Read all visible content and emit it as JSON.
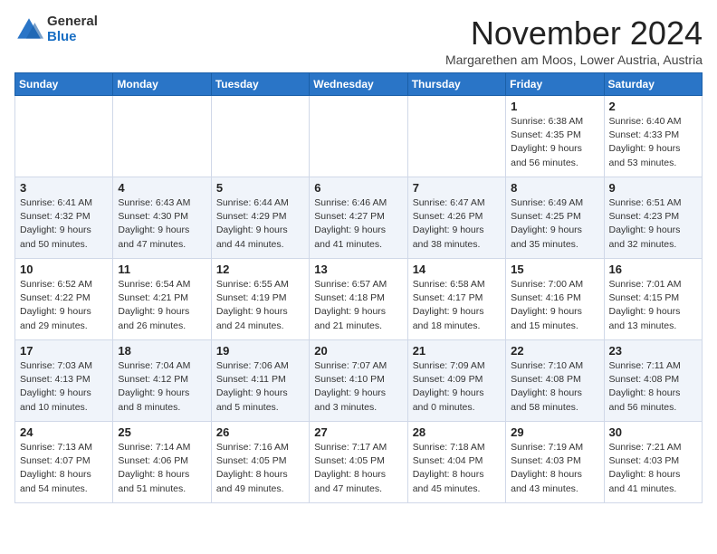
{
  "logo": {
    "general": "General",
    "blue": "Blue"
  },
  "title": "November 2024",
  "location": "Margarethen am Moos, Lower Austria, Austria",
  "weekdays": [
    "Sunday",
    "Monday",
    "Tuesday",
    "Wednesday",
    "Thursday",
    "Friday",
    "Saturday"
  ],
  "weeks": [
    [
      {
        "day": "",
        "info": ""
      },
      {
        "day": "",
        "info": ""
      },
      {
        "day": "",
        "info": ""
      },
      {
        "day": "",
        "info": ""
      },
      {
        "day": "",
        "info": ""
      },
      {
        "day": "1",
        "info": "Sunrise: 6:38 AM\nSunset: 4:35 PM\nDaylight: 9 hours\nand 56 minutes."
      },
      {
        "day": "2",
        "info": "Sunrise: 6:40 AM\nSunset: 4:33 PM\nDaylight: 9 hours\nand 53 minutes."
      }
    ],
    [
      {
        "day": "3",
        "info": "Sunrise: 6:41 AM\nSunset: 4:32 PM\nDaylight: 9 hours\nand 50 minutes."
      },
      {
        "day": "4",
        "info": "Sunrise: 6:43 AM\nSunset: 4:30 PM\nDaylight: 9 hours\nand 47 minutes."
      },
      {
        "day": "5",
        "info": "Sunrise: 6:44 AM\nSunset: 4:29 PM\nDaylight: 9 hours\nand 44 minutes."
      },
      {
        "day": "6",
        "info": "Sunrise: 6:46 AM\nSunset: 4:27 PM\nDaylight: 9 hours\nand 41 minutes."
      },
      {
        "day": "7",
        "info": "Sunrise: 6:47 AM\nSunset: 4:26 PM\nDaylight: 9 hours\nand 38 minutes."
      },
      {
        "day": "8",
        "info": "Sunrise: 6:49 AM\nSunset: 4:25 PM\nDaylight: 9 hours\nand 35 minutes."
      },
      {
        "day": "9",
        "info": "Sunrise: 6:51 AM\nSunset: 4:23 PM\nDaylight: 9 hours\nand 32 minutes."
      }
    ],
    [
      {
        "day": "10",
        "info": "Sunrise: 6:52 AM\nSunset: 4:22 PM\nDaylight: 9 hours\nand 29 minutes."
      },
      {
        "day": "11",
        "info": "Sunrise: 6:54 AM\nSunset: 4:21 PM\nDaylight: 9 hours\nand 26 minutes."
      },
      {
        "day": "12",
        "info": "Sunrise: 6:55 AM\nSunset: 4:19 PM\nDaylight: 9 hours\nand 24 minutes."
      },
      {
        "day": "13",
        "info": "Sunrise: 6:57 AM\nSunset: 4:18 PM\nDaylight: 9 hours\nand 21 minutes."
      },
      {
        "day": "14",
        "info": "Sunrise: 6:58 AM\nSunset: 4:17 PM\nDaylight: 9 hours\nand 18 minutes."
      },
      {
        "day": "15",
        "info": "Sunrise: 7:00 AM\nSunset: 4:16 PM\nDaylight: 9 hours\nand 15 minutes."
      },
      {
        "day": "16",
        "info": "Sunrise: 7:01 AM\nSunset: 4:15 PM\nDaylight: 9 hours\nand 13 minutes."
      }
    ],
    [
      {
        "day": "17",
        "info": "Sunrise: 7:03 AM\nSunset: 4:13 PM\nDaylight: 9 hours\nand 10 minutes."
      },
      {
        "day": "18",
        "info": "Sunrise: 7:04 AM\nSunset: 4:12 PM\nDaylight: 9 hours\nand 8 minutes."
      },
      {
        "day": "19",
        "info": "Sunrise: 7:06 AM\nSunset: 4:11 PM\nDaylight: 9 hours\nand 5 minutes."
      },
      {
        "day": "20",
        "info": "Sunrise: 7:07 AM\nSunset: 4:10 PM\nDaylight: 9 hours\nand 3 minutes."
      },
      {
        "day": "21",
        "info": "Sunrise: 7:09 AM\nSunset: 4:09 PM\nDaylight: 9 hours\nand 0 minutes."
      },
      {
        "day": "22",
        "info": "Sunrise: 7:10 AM\nSunset: 4:08 PM\nDaylight: 8 hours\nand 58 minutes."
      },
      {
        "day": "23",
        "info": "Sunrise: 7:11 AM\nSunset: 4:08 PM\nDaylight: 8 hours\nand 56 minutes."
      }
    ],
    [
      {
        "day": "24",
        "info": "Sunrise: 7:13 AM\nSunset: 4:07 PM\nDaylight: 8 hours\nand 54 minutes."
      },
      {
        "day": "25",
        "info": "Sunrise: 7:14 AM\nSunset: 4:06 PM\nDaylight: 8 hours\nand 51 minutes."
      },
      {
        "day": "26",
        "info": "Sunrise: 7:16 AM\nSunset: 4:05 PM\nDaylight: 8 hours\nand 49 minutes."
      },
      {
        "day": "27",
        "info": "Sunrise: 7:17 AM\nSunset: 4:05 PM\nDaylight: 8 hours\nand 47 minutes."
      },
      {
        "day": "28",
        "info": "Sunrise: 7:18 AM\nSunset: 4:04 PM\nDaylight: 8 hours\nand 45 minutes."
      },
      {
        "day": "29",
        "info": "Sunrise: 7:19 AM\nSunset: 4:03 PM\nDaylight: 8 hours\nand 43 minutes."
      },
      {
        "day": "30",
        "info": "Sunrise: 7:21 AM\nSunset: 4:03 PM\nDaylight: 8 hours\nand 41 minutes."
      }
    ]
  ]
}
